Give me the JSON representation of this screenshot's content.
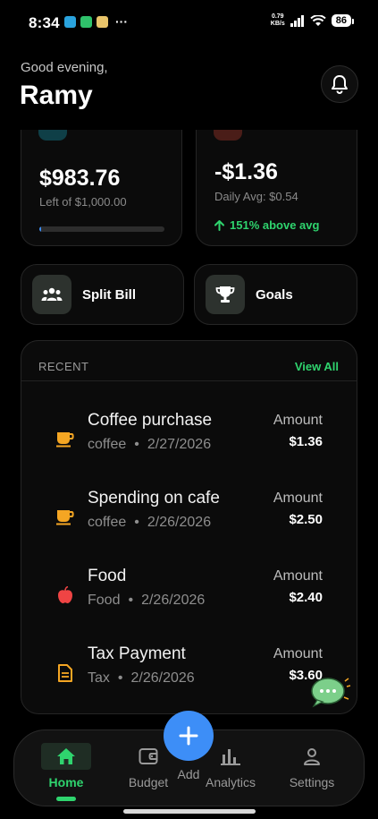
{
  "status_bar": {
    "time": "8:34",
    "net_speed_value": "0.79",
    "net_speed_unit": "KB/s",
    "battery": "86"
  },
  "header": {
    "greeting": "Good evening,",
    "user_name": "Ramy"
  },
  "budget_card": {
    "amount": "$983.76",
    "subtitle": "Left of $1,000.00",
    "progress_fraction": 0.016,
    "accent_color": "#3d8ef7"
  },
  "spend_card": {
    "amount": "-$1.36",
    "subtitle": "Daily Avg: $0.54",
    "trend": "151% above avg",
    "trend_color": "#2fd46e"
  },
  "quick_actions": [
    {
      "label": "Split Bill",
      "icon": "group-icon"
    },
    {
      "label": "Goals",
      "icon": "trophy-icon"
    }
  ],
  "recent": {
    "title": "RECENT",
    "view_all": "View All",
    "transactions": [
      {
        "title": "Coffee purchase",
        "category": "coffee",
        "date": "2/27/2026",
        "amount_label": "Amount",
        "amount": "$1.36",
        "icon": "coffee-cup-icon",
        "icon_color": "#f5a623"
      },
      {
        "title": "Spending on cafe",
        "category": "coffee",
        "date": "2/26/2026",
        "amount_label": "Amount",
        "amount": "$2.50",
        "icon": "coffee-cup-icon",
        "icon_color": "#f5a623"
      },
      {
        "title": "Food",
        "category": "Food",
        "date": "2/26/2026",
        "amount_label": "Amount",
        "amount": "$2.40",
        "icon": "apple-icon",
        "icon_color": "#ef4444"
      },
      {
        "title": "Tax Payment",
        "category": "Tax",
        "date": "2/26/2026",
        "amount_label": "Amount",
        "amount": "$3.60",
        "icon": "document-icon",
        "icon_color": "#f5a623"
      }
    ]
  },
  "bottom_nav": {
    "items": [
      {
        "label": "Home",
        "icon": "home-icon",
        "active": true
      },
      {
        "label": "Budget",
        "icon": "wallet-icon",
        "active": false
      },
      {
        "label": "Analytics",
        "icon": "bar-chart-icon",
        "active": false
      },
      {
        "label": "Settings",
        "icon": "person-icon",
        "active": false
      }
    ],
    "add_label": "Add",
    "accent_color": "#2fd46e"
  }
}
